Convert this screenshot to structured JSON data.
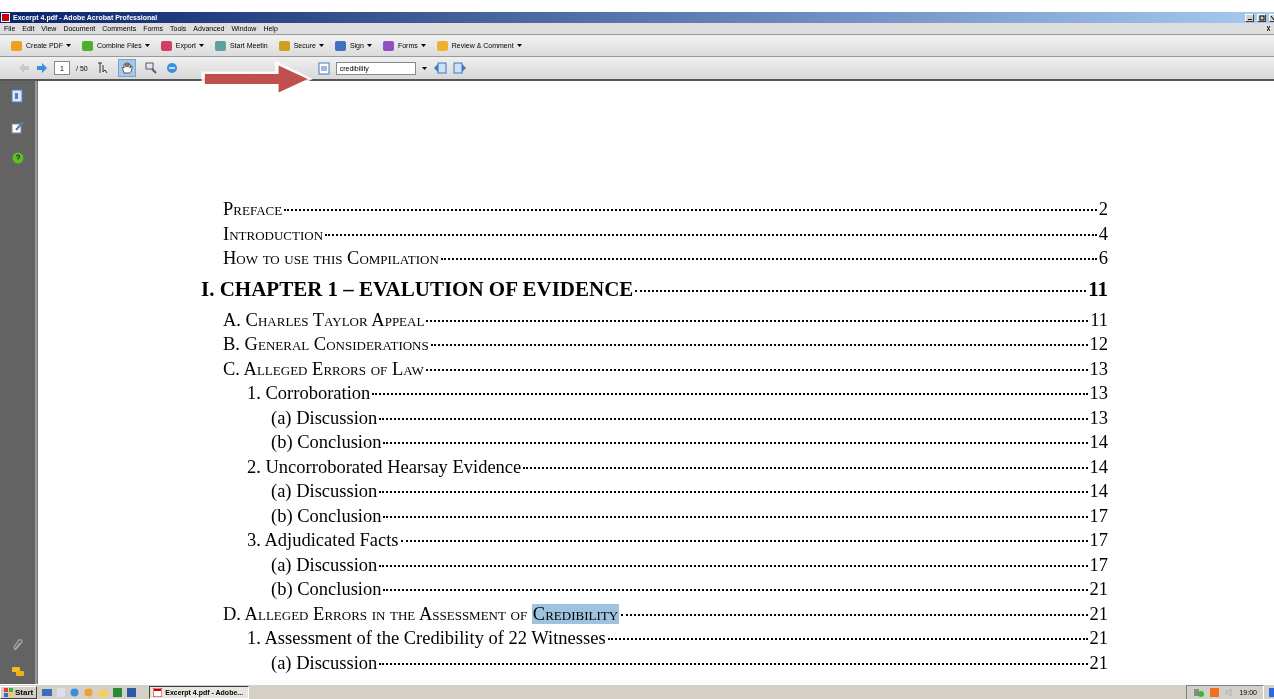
{
  "window": {
    "title": "Excerpt 4.pdf - Adobe Acrobat Professional"
  },
  "menu": [
    "File",
    "Edit",
    "View",
    "Document",
    "Comments",
    "Forms",
    "Tools",
    "Advanced",
    "Window",
    "Help"
  ],
  "toolbar": [
    {
      "label": "Create PDF",
      "kind": "create"
    },
    {
      "label": "Combine Files",
      "kind": "combine"
    },
    {
      "label": "Export",
      "kind": "export"
    },
    {
      "label": "Start Meetin",
      "kind": "meeting"
    },
    {
      "label": "Secure",
      "kind": "secure"
    },
    {
      "label": "Sign",
      "kind": "sign"
    },
    {
      "label": "Forms",
      "kind": "forms"
    },
    {
      "label": "Review & Comment",
      "kind": "review"
    }
  ],
  "navigation": {
    "page": "1",
    "total": "/ 50",
    "search": "credibility",
    "tools": [
      {
        "kind": "select",
        "selected": false
      },
      {
        "kind": "hand",
        "selected": true
      },
      {
        "kind": "zoom",
        "selected": false
      }
    ]
  },
  "toc": [
    {
      "kind": "section",
      "title": "Preface",
      "page": "2"
    },
    {
      "kind": "section",
      "title": "Introduction",
      "page": "4"
    },
    {
      "kind": "section",
      "title": "How to use this Compilation",
      "page": "6"
    },
    {
      "kind": "chapter",
      "title": "I. CHAPTER 1 – EVALUTION OF EVIDENCE",
      "page": "11",
      "children": [
        {
          "kind": "section",
          "title": "A. Charles Taylor Appeal",
          "page": "11"
        },
        {
          "kind": "section",
          "title": "B. General Considerations",
          "page": "12"
        },
        {
          "kind": "section",
          "title": "C. Alleged Errors of Law",
          "page": "13",
          "children": [
            {
              "kind": "item",
              "title": "1. Corroboration",
              "page": "13",
              "children": [
                {
                  "kind": "item",
                  "title": "(a) Discussion",
                  "page": "13"
                },
                {
                  "kind": "item",
                  "title": "(b) Conclusion",
                  "page": "14"
                }
              ]
            },
            {
              "kind": "item",
              "title": "2. Uncorroborated Hearsay Evidence",
              "page": "14",
              "children": [
                {
                  "kind": "item",
                  "title": "(a) Discussion",
                  "page": "14"
                },
                {
                  "kind": "item",
                  "title": "(b) Conclusion",
                  "page": "17"
                }
              ]
            },
            {
              "kind": "item",
              "title": "3. Adjudicated Facts",
              "page": "17",
              "children": [
                {
                  "kind": "item",
                  "title": "(a) Discussion",
                  "page": "17"
                },
                {
                  "kind": "item",
                  "title": "(b) Conclusion",
                  "page": "21"
                }
              ]
            }
          ]
        },
        {
          "kind": "section",
          "title": "D. Alleged Errors in the Assessment of ",
          "highlight": "Credibility",
          "page": "21",
          "children": [
            {
              "kind": "item",
              "title": "1. Assessment of the Credibility of 22 Witnesses",
              "page": "21",
              "children": [
                {
                  "kind": "item",
                  "title": "(a) Discussion",
                  "page": "21"
                }
              ]
            }
          ]
        }
      ]
    }
  ],
  "taskbar": {
    "start": "Start",
    "task": "Excerpt 4.pdf - Adobe...",
    "clock": "19:00"
  }
}
